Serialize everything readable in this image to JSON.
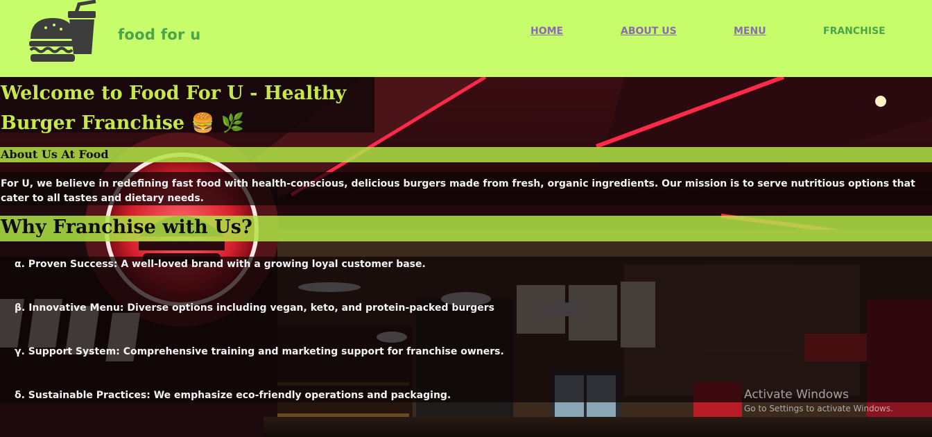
{
  "header": {
    "brand": "food for u",
    "nav": [
      {
        "label": "HOME"
      },
      {
        "label": "ABOUT US"
      },
      {
        "label": "MENU"
      },
      {
        "label": "FRANCHISE"
      }
    ]
  },
  "hero": {
    "title": "Welcome to Food For U - Healthy Burger Franchise 🍔 🌿"
  },
  "about": {
    "heading": "About Us At Food",
    "text": "For U, we believe in redefining fast food with health-conscious, delicious burgers made from fresh, organic ingredients. Our mission is to serve nutritious options that cater to all tastes and dietary needs."
  },
  "why": {
    "heading": "Why Franchise with Us?",
    "items": [
      "α. Proven Success: A well-loved brand with a growing loyal customer base.",
      "β. Innovative Menu: Diverse options including vegan, keto, and protein-packed burgers",
      "γ. Support System: Comprehensive training and marketing support for franchise owners.",
      "δ. Sustainable Practices: We emphasize eco-friendly operations and packaging."
    ]
  },
  "watermark": {
    "line1": "Activate Windows",
    "line2": "Go to Settings to activate Windows."
  },
  "colors": {
    "header_bg": "#c7fd6b",
    "brand_green": "#4aa44a",
    "nav_purple": "#8a69b5",
    "title_yellow_green": "#c7e84a"
  }
}
